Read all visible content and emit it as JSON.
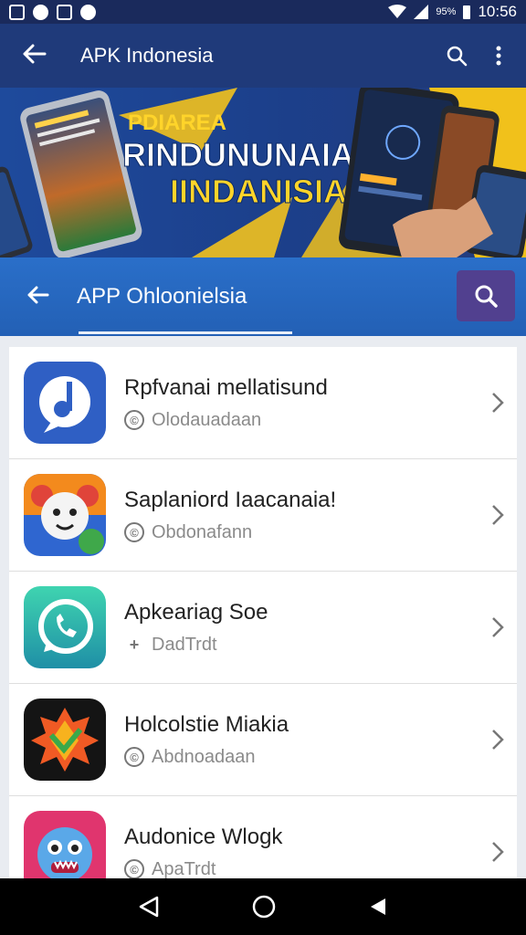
{
  "status_bar": {
    "battery_percent": "95%",
    "time": "10:56"
  },
  "app_bar": {
    "title": "APK Indonesia"
  },
  "banner": {
    "line1": "PDIAREA",
    "line2": "RINDUNUNAIAA",
    "line3": "IINDANISIA"
  },
  "search": {
    "query": "APP Ohloonielsia"
  },
  "apps": [
    {
      "name": "Rpfvanai mellatisund",
      "meta": "Olodauadaan",
      "meta_icon": "copyright-icon"
    },
    {
      "name": "Saplaniord Iaacanaia!",
      "meta": "Obdonafann",
      "meta_icon": "copyright-icon"
    },
    {
      "name": "Apkeariag Soe",
      "meta": "DadTrdt",
      "meta_icon": "expand-icon"
    },
    {
      "name": "Holcolstie Miakia",
      "meta": "Abdnoadaan",
      "meta_icon": "copyright-icon"
    },
    {
      "name": "Audonice Wlogk",
      "meta": "ApaTrdt",
      "meta_icon": "copyright-icon"
    }
  ],
  "colors": {
    "status_bar": "#1a2a5c",
    "app_bar": "#1f3a7a",
    "search_bar": "#2a6fc9",
    "search_button": "#51408f",
    "banner_title": "#ffd42a"
  }
}
